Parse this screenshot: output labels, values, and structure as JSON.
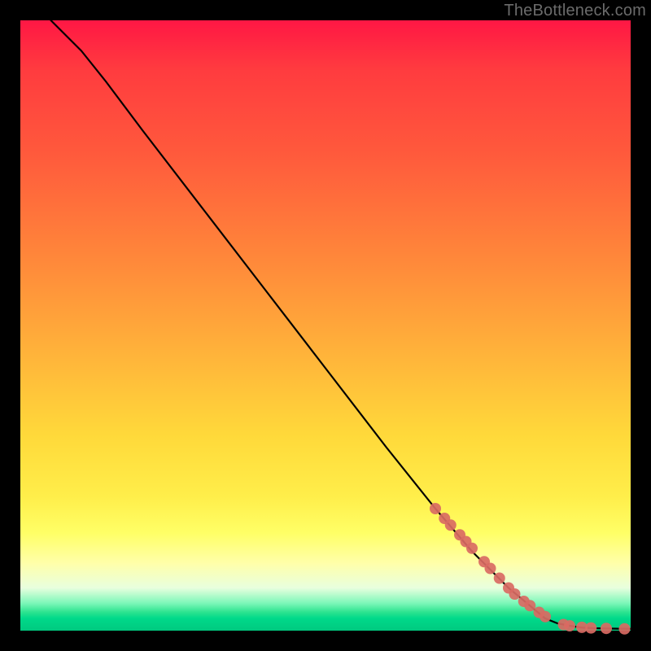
{
  "watermark": "TheBottleneck.com",
  "chart_data": {
    "type": "line",
    "title": "",
    "xlabel": "",
    "ylabel": "",
    "xlim": [
      0,
      100
    ],
    "ylim": [
      0,
      100
    ],
    "grid": false,
    "legend": false,
    "series": [
      {
        "name": "curve",
        "kind": "line",
        "color": "#000000",
        "x": [
          5,
          7,
          10,
          14,
          20,
          30,
          40,
          50,
          60,
          68,
          74,
          80,
          86,
          88,
          90,
          92,
          94,
          96,
          98,
          100
        ],
        "y": [
          100,
          98,
          95,
          90,
          82,
          69,
          56,
          43,
          30,
          20,
          13,
          7,
          2,
          1.2,
          0.8,
          0.5,
          0.4,
          0.35,
          0.32,
          0.3
        ]
      },
      {
        "name": "highlight-dots",
        "kind": "scatter",
        "color": "#d96a63",
        "radius_px": 7,
        "x": [
          68,
          69.5,
          70.5,
          72,
          73,
          74,
          76,
          77,
          78.5,
          80,
          81,
          82.5,
          83.5,
          85,
          86,
          89,
          90,
          92,
          93.5,
          96,
          99
        ],
        "y": [
          20,
          18.4,
          17.3,
          15.7,
          14.6,
          13.5,
          11.3,
          10.2,
          8.6,
          7,
          6,
          4.8,
          4.1,
          3,
          2.3,
          1,
          0.8,
          0.55,
          0.45,
          0.37,
          0.3
        ]
      }
    ],
    "background_gradient": {
      "direction": "top-to-bottom",
      "stops": [
        {
          "pos": 0.0,
          "color": "#ff1744"
        },
        {
          "pos": 0.4,
          "color": "#ff8a3a"
        },
        {
          "pos": 0.68,
          "color": "#ffd93a"
        },
        {
          "pos": 0.85,
          "color": "#ffff70"
        },
        {
          "pos": 0.95,
          "color": "#7cf7b8"
        },
        {
          "pos": 1.0,
          "color": "#00c97f"
        }
      ]
    }
  }
}
